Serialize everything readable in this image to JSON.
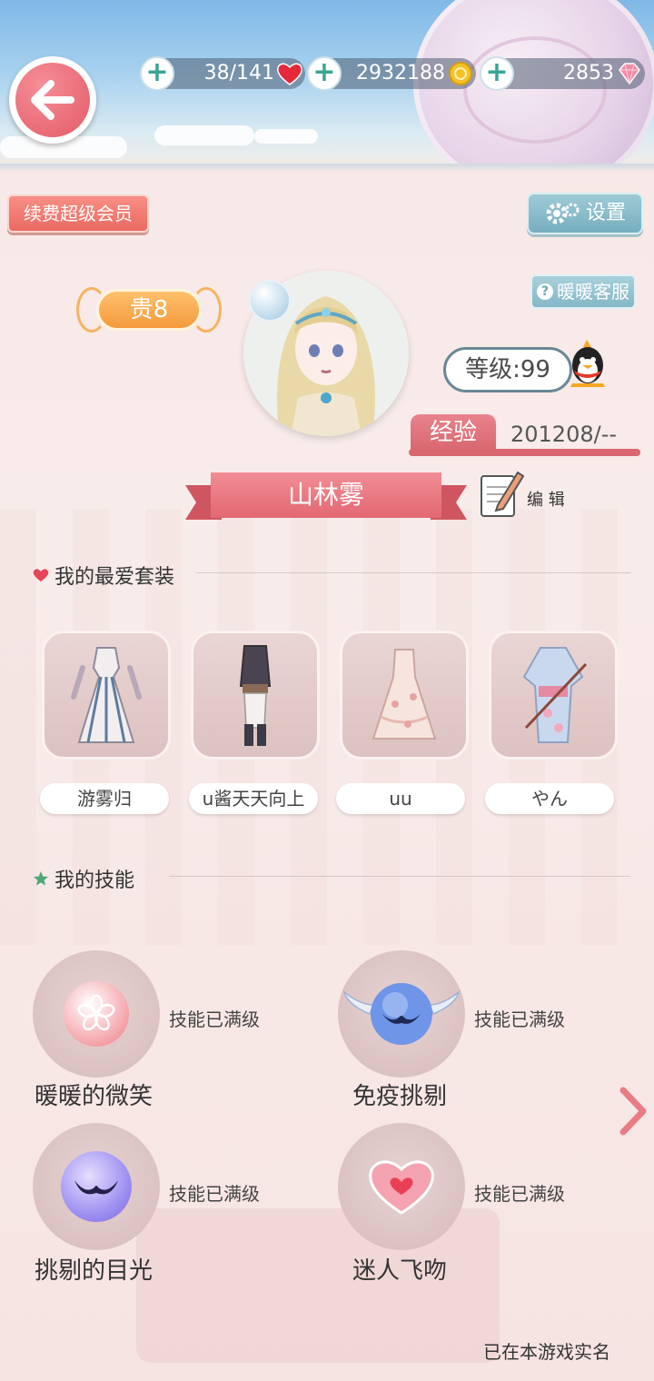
{
  "resources": {
    "stamina": "38/141",
    "gold": "2932188",
    "diamonds": "2853",
    "plus": "+"
  },
  "buttons": {
    "vip_renew": "续费超级会员",
    "settings": "设置",
    "customer_service": "暖暖客服",
    "edit": "编 辑"
  },
  "profile": {
    "vip_level": "贵8",
    "level": "等级:99",
    "exp_label": "经验",
    "exp_value": "201208/--",
    "name": "山林雾"
  },
  "favorites": {
    "title": "我的最爱套装",
    "items": [
      {
        "label": "游雾归"
      },
      {
        "label": "u酱天天向上"
      },
      {
        "label": "uu"
      },
      {
        "label": "やん"
      }
    ]
  },
  "skills": {
    "title": "我的技能",
    "items": [
      {
        "name": "暖暖的微笑",
        "status": "技能已满级",
        "icon": "sakura-icon"
      },
      {
        "name": "免疫挑剔",
        "status": "技能已满级",
        "icon": "winged-mask-icon"
      },
      {
        "name": "挑剔的目光",
        "status": "技能已满级",
        "icon": "mask-icon"
      },
      {
        "name": "迷人飞吻",
        "status": "技能已满级",
        "icon": "heart-icon"
      }
    ]
  },
  "footer": {
    "realname": "已在本游戏实名"
  },
  "colors": {
    "accent_pink": "#e26872",
    "teal_button": "#76aebf",
    "gold_badge": "#f49a3c"
  }
}
